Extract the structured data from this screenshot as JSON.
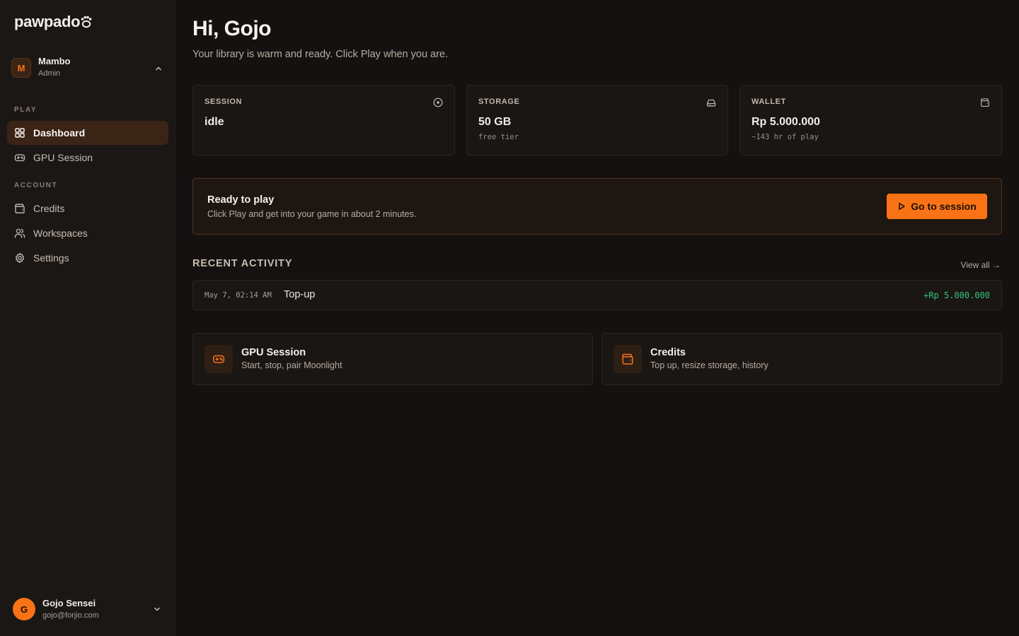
{
  "app": {
    "logo_text": "pawpado"
  },
  "workspace": {
    "initial": "M",
    "name": "Mambo",
    "role": "Admin"
  },
  "sidebar": {
    "sections": [
      {
        "title": "PLAY",
        "items": [
          {
            "label": "Dashboard",
            "icon": "grid-icon",
            "active": true
          },
          {
            "label": "GPU Session",
            "icon": "gamepad-icon",
            "active": false
          }
        ]
      },
      {
        "title": "ACCOUNT",
        "items": [
          {
            "label": "Credits",
            "icon": "wallet-icon",
            "active": false
          },
          {
            "label": "Workspaces",
            "icon": "users-icon",
            "active": false
          },
          {
            "label": "Settings",
            "icon": "gear-icon",
            "active": false
          }
        ]
      }
    ]
  },
  "user": {
    "initial": "G",
    "name": "Gojo Sensei",
    "email": "gojo@forjio.com"
  },
  "header": {
    "greeting": "Hi, Gojo",
    "subtitle": "Your library is warm and ready. Click Play when you are."
  },
  "stats": [
    {
      "label": "SESSION",
      "value": "idle",
      "note": "",
      "icon": "clock-icon"
    },
    {
      "label": "STORAGE",
      "value": "50 GB",
      "note": "free tier",
      "icon": "drive-icon"
    },
    {
      "label": "WALLET",
      "value": "Rp 5.000.000",
      "note": "~143 hr of play",
      "icon": "wallet-icon"
    }
  ],
  "ready": {
    "title": "Ready to play",
    "subtitle": "Click Play and get into your game in about 2 minutes.",
    "button_label": "Go to session"
  },
  "recent": {
    "title": "RECENT ACTIVITY",
    "view_all": "View all →",
    "rows": [
      {
        "date": "May 7, 02:14 AM",
        "type": "Top-up",
        "amount": "+Rp 5.000.000"
      }
    ]
  },
  "quick_links": [
    {
      "title": "GPU Session",
      "subtitle": "Start, stop, pair Moonlight",
      "icon": "gamepad-icon"
    },
    {
      "title": "Credits",
      "subtitle": "Top up, resize storage, history",
      "icon": "wallet-icon"
    }
  ],
  "colors": {
    "accent": "#f97316",
    "positive": "#34c27a",
    "background": "#141110",
    "sidebar": "#1b1715"
  }
}
